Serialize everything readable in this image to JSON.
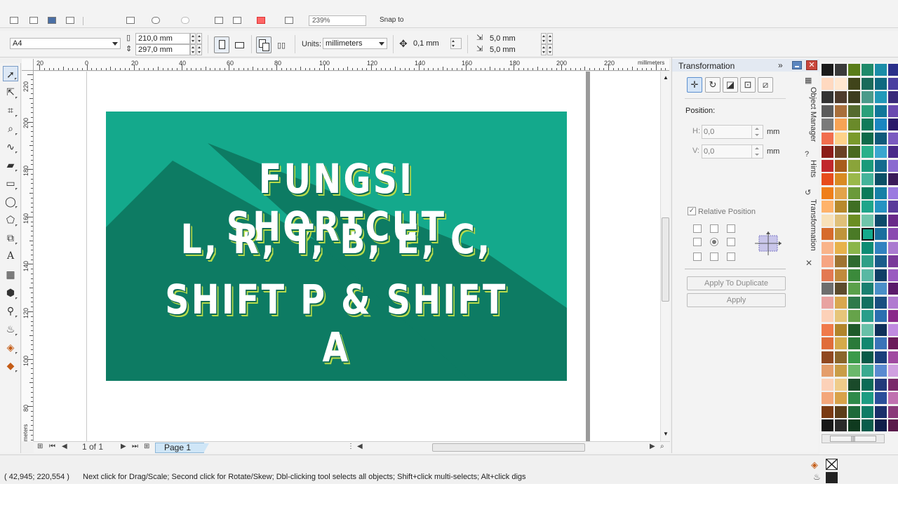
{
  "toolbar": {
    "zoom_value": "239%",
    "snap_label": "Snap to"
  },
  "propbar": {
    "page_preset": "A4",
    "page_width": "210,0 mm",
    "page_height": "297,0 mm",
    "units_label": "Units:",
    "units_value": "millimeters",
    "nudge_value": "0,1 mm",
    "duplicate_x": "5,0 mm",
    "duplicate_y": "5,0 mm"
  },
  "ruler": {
    "top_labels": [
      "20",
      "0",
      "20",
      "40",
      "60",
      "80",
      "100",
      "120",
      "140",
      "160",
      "180",
      "200",
      "220"
    ],
    "top_unit": "millimeters",
    "left_labels": [
      "220",
      "200",
      "180",
      "160",
      "140",
      "120",
      "100",
      "80"
    ],
    "left_unit": "millimeters"
  },
  "banner": {
    "line1": "FUNGSI SHORTCUT",
    "line2": "L, R, T, B, E, C,",
    "line3": "SHIFT P & SHIFT A"
  },
  "pagenav": {
    "page_count": "1 of 1",
    "page_tab": "Page 1"
  },
  "docker": {
    "title": "Transformation",
    "position_label": "Position:",
    "h_label": "H:",
    "h_value": "0,0",
    "v_label": "V:",
    "v_value": "0,0",
    "unit": "mm",
    "relative_position": "Relative Position",
    "apply_duplicate": "Apply To Duplicate",
    "apply": "Apply"
  },
  "side_tabs": {
    "object_manager": "Object Manager",
    "hints": "Hints",
    "transformation": "Transformation"
  },
  "status": {
    "coords": "( 42,945; 220,554 )",
    "hint": "Next click for Drag/Scale; Second click for Rotate/Skew; Dbl-clicking tool selects all objects; Shift+click multi-selects; Alt+click digs"
  },
  "colors": {
    "banner_bg": "#14a98c",
    "banner_shadow": "#0d7b63",
    "banner_text": "#ffffff",
    "banner_outline": "#b8dc4a"
  },
  "palette": {
    "columns": [
      [
        "#1a1a1a",
        "#ffd9c0",
        "#333333",
        "#5c5c5c",
        "#7a7a7a",
        "#f16d4e",
        "#8b1c18",
        "#c1272d",
        "#e74c1c",
        "#ef7f1a",
        "#ffb36b",
        "#f8e1b8",
        "#d66b2b",
        "#f9b48a",
        "#f6a583",
        "#e37952",
        "#6d6d6d",
        "#e8a2a0",
        "#fcd1b8",
        "#f07a4a",
        "#e06d3a",
        "#904820",
        "#e49e6c",
        "#fcd1b8",
        "#f3a67a",
        "#7a3a12",
        "#181818"
      ],
      [
        "#3a3a3a",
        "#ffe7d0",
        "#4d3b2c",
        "#a86f3b",
        "#f7a355",
        "#fdd28a",
        "#6b4124",
        "#a85c1c",
        "#d98b23",
        "#e2a34a",
        "#b8892c",
        "#e0c079",
        "#c0943b",
        "#e7b24b",
        "#a07431",
        "#c18a3c",
        "#5c4b2d",
        "#d9a74f",
        "#e6c57a",
        "#b1852b",
        "#d5aa4a",
        "#8a652b",
        "#c99d47",
        "#efcc8a",
        "#d8a24a",
        "#5b3d1a",
        "#2a2a2a"
      ],
      [
        "#5a7d1a",
        "#40441a",
        "#3d3d1f",
        "#556b2f",
        "#6a8a2a",
        "#7a9a2c",
        "#4a6a20",
        "#8aa43a",
        "#9ab84a",
        "#6a9a3a",
        "#3f6f24",
        "#6b8e23",
        "#4a7a26",
        "#8bb54a",
        "#2f6a2f",
        "#3b8a3b",
        "#5aa04a",
        "#2f7a4a",
        "#66a34a",
        "#1f5a2a",
        "#2a7a3a",
        "#3a9a4a",
        "#6bb86b",
        "#1a4a2a",
        "#2f8a4a",
        "#1f6a3a",
        "#0f3a1f"
      ],
      [
        "#1f8a6a",
        "#1a6a5a",
        "#4a9a8a",
        "#2aa07a",
        "#107a5a",
        "#0f6a4a",
        "#2ab08a",
        "#1a9a7a",
        "#44b39a",
        "#0a7a5a",
        "#1fa58a",
        "#6fc5aa",
        "#14a98c",
        "#0e8c74",
        "#2f9f87",
        "#58b8a3",
        "#1a8070",
        "#127060",
        "#2a9e8a",
        "#68c0a8",
        "#13876f",
        "#095a48",
        "#3aaa90",
        "#0b6b57",
        "#1c9c82",
        "#0f7b65",
        "#0a5c4b"
      ],
      [
        "#1b8da8",
        "#0f6a80",
        "#2299b8",
        "#117799",
        "#1a86c0",
        "#0f5a7a",
        "#3aa6cf",
        "#146c8e",
        "#0c4f66",
        "#1580a6",
        "#2693c2",
        "#0d4a6a",
        "#1a6f9e",
        "#3182c0",
        "#1a5c8a",
        "#0f3f66",
        "#4a8fc8",
        "#1a4f80",
        "#2b6fb0",
        "#0f2f5a",
        "#3a73b8",
        "#1a3f7a",
        "#5a8ad0",
        "#223a7a",
        "#2a4f9a",
        "#1a2f6a",
        "#0f1f4a"
      ],
      [
        "#2a2f8a",
        "#4a3fa0",
        "#3a2a7a",
        "#6a4ab0",
        "#2a1a6a",
        "#7a5ac0",
        "#4a2a8a",
        "#8a6ad0",
        "#3a1a5a",
        "#9a7ae0",
        "#5a3a9a",
        "#6a2a8a",
        "#8a4ab0",
        "#aa7ad0",
        "#7a3a9a",
        "#9a5ac0",
        "#5a1a6a",
        "#b07ad0",
        "#8a2a8a",
        "#c08ae0",
        "#6a1a5a",
        "#a04aa0",
        "#d0a0e0",
        "#7a2a6a",
        "#c070b0",
        "#8a3a7a",
        "#5a1a4a"
      ]
    ]
  }
}
